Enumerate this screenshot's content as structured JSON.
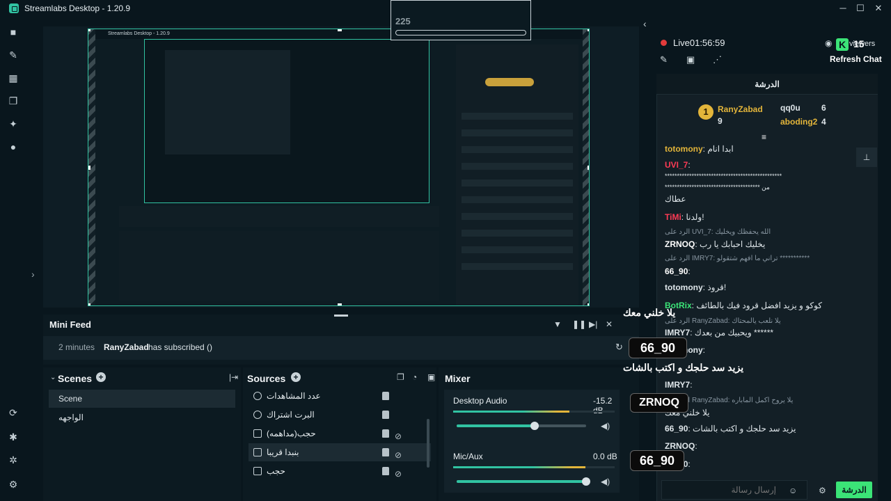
{
  "app": {
    "title": "Streamlabs Desktop - 1.20.9"
  },
  "nested": {
    "title": "Streamlabs Desktop - 1.20.9",
    "counter": "225"
  },
  "mini_feed": {
    "title": "Mini Feed",
    "entry": {
      "time": "2 minutes",
      "user": "RanyZabad",
      "action": "has subscribed ()"
    }
  },
  "scenes": {
    "title": "Scenes",
    "items": [
      "Scene",
      "الواجهه"
    ],
    "selected": "Scene"
  },
  "sources": {
    "title": "Sources",
    "items": [
      "عدد المشاهدات",
      "البرت اشتراك",
      "حجب(مداهمه)",
      "بنبدا قريبا",
      "حجب"
    ],
    "selected": "بنبدا قريبا"
  },
  "mixer": {
    "title": "Mixer",
    "channels": [
      {
        "name": "Desktop Audio",
        "db": "-15.2 dB",
        "level": 0.72,
        "volume": 0.6
      },
      {
        "name": "Mic/Aux",
        "db": "0.0 dB",
        "level": 0.82,
        "volume": 1.0
      }
    ]
  },
  "live": {
    "status": "Live",
    "timer": "01:56:59",
    "viewers": "15",
    "viewers_label": "viewers",
    "refresh": "Refresh Chat"
  },
  "chat": {
    "header": "الدرشة",
    "leaderboard": [
      {
        "name": "RanyZabad",
        "count": "9"
      },
      {
        "name": "qq0u",
        "count": "6"
      },
      {
        "name": "aboding2",
        "count": "4"
      }
    ],
    "messages": [
      {
        "user": "totomony",
        "text": "ابدا انام"
      },
      {
        "user": "UVI_7",
        "text": "************************************************"
      },
      {
        "user": "",
        "text": "*************************************** من"
      },
      {
        "user": "",
        "text": "عطاك"
      },
      {
        "user": "TiMi",
        "text": "ولدنا!"
      },
      {
        "user": "",
        "text": "الرد على UVI_7: الله يحفظك ويخليك"
      },
      {
        "user": "ZRNOQ",
        "text": "يخليك احبابك يا رب"
      },
      {
        "user": "",
        "text": "الرد على IMRY7: تراني ما افهم شتقولو ***********"
      },
      {
        "user": "66_90",
        "text": ""
      },
      {
        "user": "totomony",
        "text": "قروذ!"
      },
      {
        "user": "BotRix",
        "text": "كوكو و يزيد افضل قرود فيك بالطائف"
      },
      {
        "user": "RanyZabad",
        "text": "الرد على RanyZabad: يلا نلعب يالمحتاك"
      },
      {
        "user": "IMRY7",
        "text": "ويحبيك من بعدك ******"
      },
      {
        "user": "totomony",
        "text": ""
      },
      {
        "user": "IMRY7",
        "text": ""
      },
      {
        "user": "RanyZabad",
        "text": "الرد على RanyZabad: يلا يروح اكمل الماباره"
      },
      {
        "user": "",
        "text": "يلا خلني معك"
      },
      {
        "user": "66_90",
        "text": "يزيد سد حلجك و اكتب بالشات"
      },
      {
        "user": "ZRNOQ",
        "text": ""
      },
      {
        "user": "66_90",
        "text": ""
      }
    ],
    "input_placeholder": "إرسال رسالة",
    "send": "الدرشة"
  },
  "alerts": [
    {
      "text": "يلا خلني معك"
    },
    {
      "text": "66_90"
    },
    {
      "text": "يزيد سد حلجك و اكتب بالشات"
    },
    {
      "text": "ZRNOQ"
    },
    {
      "text": "66_90"
    }
  ],
  "colors": {
    "accent": "#31c3a2",
    "kick": "#3be477",
    "bg": "#09161d",
    "live": "#e23b3b"
  }
}
